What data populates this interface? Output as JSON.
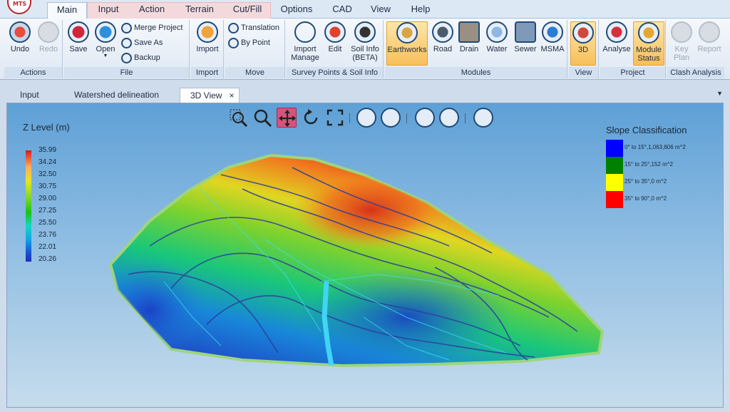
{
  "app": {
    "logo_text": "MTS"
  },
  "menu_tabs": [
    "Main",
    "Input",
    "Action",
    "Terrain",
    "Cut/Fill",
    "Options",
    "CAD",
    "View",
    "Help"
  ],
  "ribbon": {
    "actions": {
      "title": "Actions",
      "undo": "Undo",
      "redo": "Redo"
    },
    "file": {
      "title": "File",
      "save": "Save",
      "open": "Open",
      "merge_project": "Merge Project",
      "save_as": "Save As",
      "backup": "Backup"
    },
    "import": {
      "title": "Import",
      "import": "Import"
    },
    "move": {
      "title": "Move",
      "translation": "Translation",
      "by_point": "By Point"
    },
    "survey": {
      "title": "Survey Points & Soil Info",
      "import_manage_1": "Import",
      "import_manage_2": "Manage",
      "edit": "Edit",
      "soil_info_1": "Soil Info",
      "soil_info_2": "(BETA)"
    },
    "modules": {
      "title": "Modules",
      "earthworks": "Earthworks",
      "road": "Road",
      "drain": "Drain",
      "water": "Water",
      "sewer": "Sewer",
      "msma": "MSMA"
    },
    "view": {
      "title": "View",
      "three_d": "3D"
    },
    "project": {
      "title": "Project",
      "analyse": "Analyse",
      "module_status_1": "Module",
      "module_status_2": "Status"
    },
    "clash": {
      "title": "Clash Analysis",
      "key_plan_1": "Key",
      "key_plan_2": "Plan",
      "report": "Report"
    }
  },
  "doc_tabs": {
    "input": "Input",
    "watershed": "Watershed delineation",
    "view3d": "3D View",
    "close": "×"
  },
  "z_legend": {
    "title": "Z Level (m)",
    "ticks": [
      "35.99",
      "34.24",
      "32.50",
      "30.75",
      "29.00",
      "27.25",
      "25.50",
      "23.76",
      "22.01",
      "20.26"
    ]
  },
  "slope_legend": {
    "title": "Slope Classification",
    "items": [
      {
        "label": "0° to 15°,1,063,806 m^2",
        "color": "#0000ff"
      },
      {
        "label": "15° to 25°,152 m^2",
        "color": "#008000"
      },
      {
        "label": "25° to 35°,0 m^2",
        "color": "#ffff00"
      },
      {
        "label": "35° to 90°,0 m^2",
        "color": "#ff0000"
      }
    ]
  },
  "colors": {
    "accent_active": "#f8bf5b",
    "pan_active": "#d7537b"
  }
}
